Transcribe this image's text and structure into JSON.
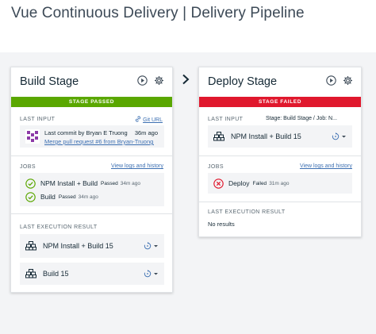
{
  "page": {
    "title": "Vue Continuous Delivery | Delivery Pipeline"
  },
  "colors": {
    "passed": "#5aa700",
    "failed": "#e0182d",
    "link": "#3d70b2",
    "canvas": "#f3f4f6"
  },
  "connector": {
    "icon": "chevron-right-icon"
  },
  "build_stage": {
    "title": "Build Stage",
    "icons": [
      "play-icon",
      "gear-icon"
    ],
    "status": "STAGE PASSED",
    "last_input": {
      "label": "LAST INPUT",
      "link_label": "Git URL",
      "link_icon": "git-icon",
      "commit_text": "Last commit by Bryan E Truong",
      "commit_time": "36m ago",
      "commit_link": "Merge pull request #6 from Bryan-Truong..."
    },
    "jobs": {
      "label": "JOBS",
      "link_label": "View logs and history",
      "items": [
        {
          "name": "NPM Install + Build",
          "status": "Passed",
          "time": "34m ago",
          "icon": "check-circle-icon"
        },
        {
          "name": "Build",
          "status": "Passed",
          "time": "34m ago",
          "icon": "check-circle-icon"
        }
      ]
    },
    "last_execution": {
      "label": "LAST EXECUTION RESULT",
      "items": [
        {
          "name": "NPM Install + Build 15",
          "icon": "build-icon"
        },
        {
          "name": "Build 15",
          "icon": "build-icon"
        }
      ]
    }
  },
  "deploy_stage": {
    "title": "Deploy Stage",
    "icons": [
      "play-icon",
      "gear-icon"
    ],
    "status": "STAGE FAILED",
    "last_input": {
      "label": "LAST INPUT",
      "source": "Stage: Build Stage  /  Job: N...",
      "item": {
        "name": "NPM Install + Build 15",
        "icon": "build-icon"
      }
    },
    "jobs": {
      "label": "JOBS",
      "link_label": "View logs and history",
      "items": [
        {
          "name": "Deploy",
          "status": "Failed",
          "time": "31m ago",
          "icon": "error-circle-icon"
        }
      ]
    },
    "last_execution": {
      "label": "LAST EXECUTION RESULT",
      "empty_text": "No results"
    }
  }
}
